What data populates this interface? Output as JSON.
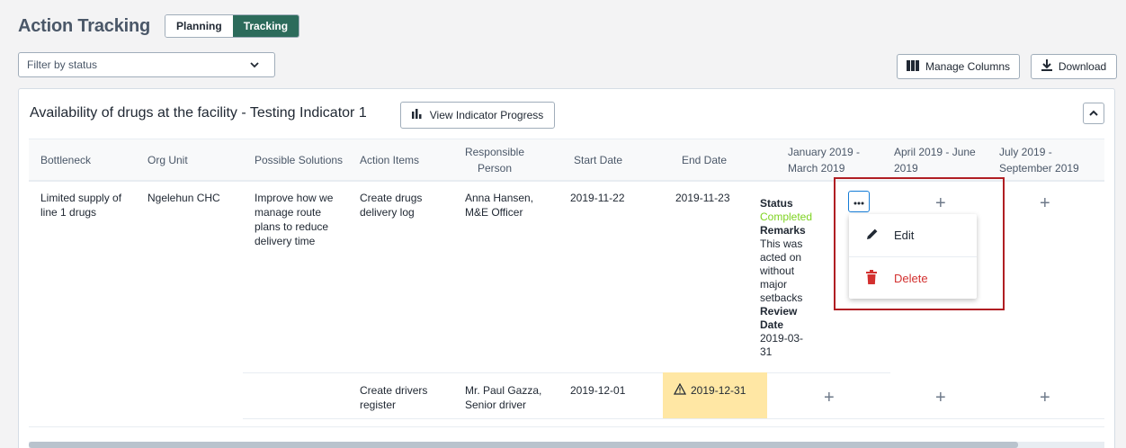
{
  "header": {
    "title": "Action Tracking",
    "tabs": [
      {
        "label": "Planning",
        "active": false
      },
      {
        "label": "Tracking",
        "active": true
      }
    ]
  },
  "filter": {
    "placeholder": "Filter by status"
  },
  "toolbar": {
    "manage_columns_label": "Manage Columns",
    "download_label": "Download"
  },
  "card": {
    "title": "Availability of drugs at the facility - Testing Indicator 1",
    "view_progress_label": "View Indicator Progress"
  },
  "table": {
    "columns": [
      "Bottleneck",
      "Org Unit",
      "Possible Solutions",
      "Action Items",
      "Responsible Person",
      "Start Date",
      "End Date",
      "January 2019 - March 2019",
      "April 2019 - June 2019",
      "July 2019 - September 2019"
    ],
    "group": {
      "bottleneck": "Limited supply of line 1 drugs",
      "org_unit": "Ngelehun CHC",
      "possible_solution": "Improve how we manage route plans to reduce delivery time"
    },
    "rows": [
      {
        "action_item": "Create drugs delivery log",
        "responsible": "Anna Hansen, M&E Officer",
        "start_date": "2019-11-22",
        "end_date": "2019-11-23",
        "q1": {
          "status_label": "Status",
          "status_value": "Completed",
          "remarks_label": "Remarks",
          "remarks_value": "This was acted on without major setbacks",
          "review_label": "Review Date",
          "review_value": "2019-03-31"
        }
      },
      {
        "action_item": "Create drivers register",
        "responsible": "Mr. Paul Gazza, Senior driver",
        "start_date": "2019-12-01",
        "end_date": "2019-12-31",
        "end_date_overdue": true
      }
    ]
  },
  "context_menu": {
    "edit_label": "Edit",
    "delete_label": "Delete"
  },
  "colors": {
    "accent": "#2c6b5b",
    "completed": "#7ed321",
    "warning_bg": "#ffe7a4",
    "delete": "#d3302f",
    "highlight": "#b01e23"
  }
}
